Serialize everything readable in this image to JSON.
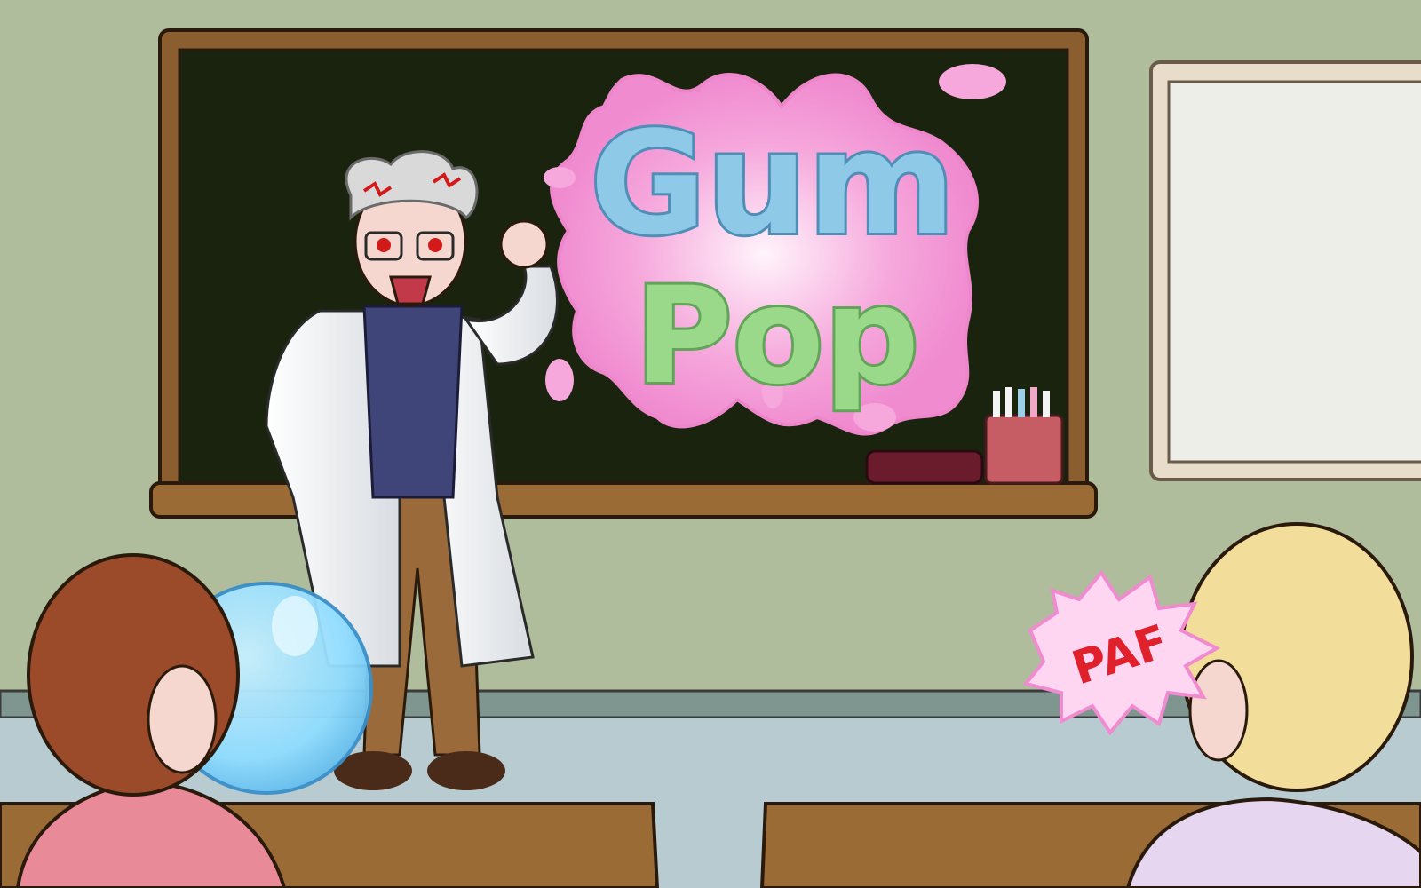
{
  "scene": {
    "title_logo": {
      "line1": "Gum",
      "line2": "Pop"
    },
    "sound_effect": "PAF"
  },
  "colors": {
    "wall": "#b0bd9c",
    "chalkboard": "#1a230d",
    "board_frame": "#8b5e2f",
    "gum_pink": "#f6a8dc",
    "gum_blue": "#8fc9e8",
    "gum_green": "#9bd98a",
    "bubble_blue": "#8fdcff",
    "floor": "#b7cbd0",
    "desk": "#9a6b35",
    "sfx_red": "#e0202b",
    "sfx_burst": "#ffd6f2"
  },
  "icons": {
    "teacher": "angry-scientist-teacher",
    "student_left": "student-blowing-bubble",
    "student_right": "blonde-student-hit",
    "chalk_holder": "chalk-cup-icon",
    "eraser": "eraser-icon"
  }
}
